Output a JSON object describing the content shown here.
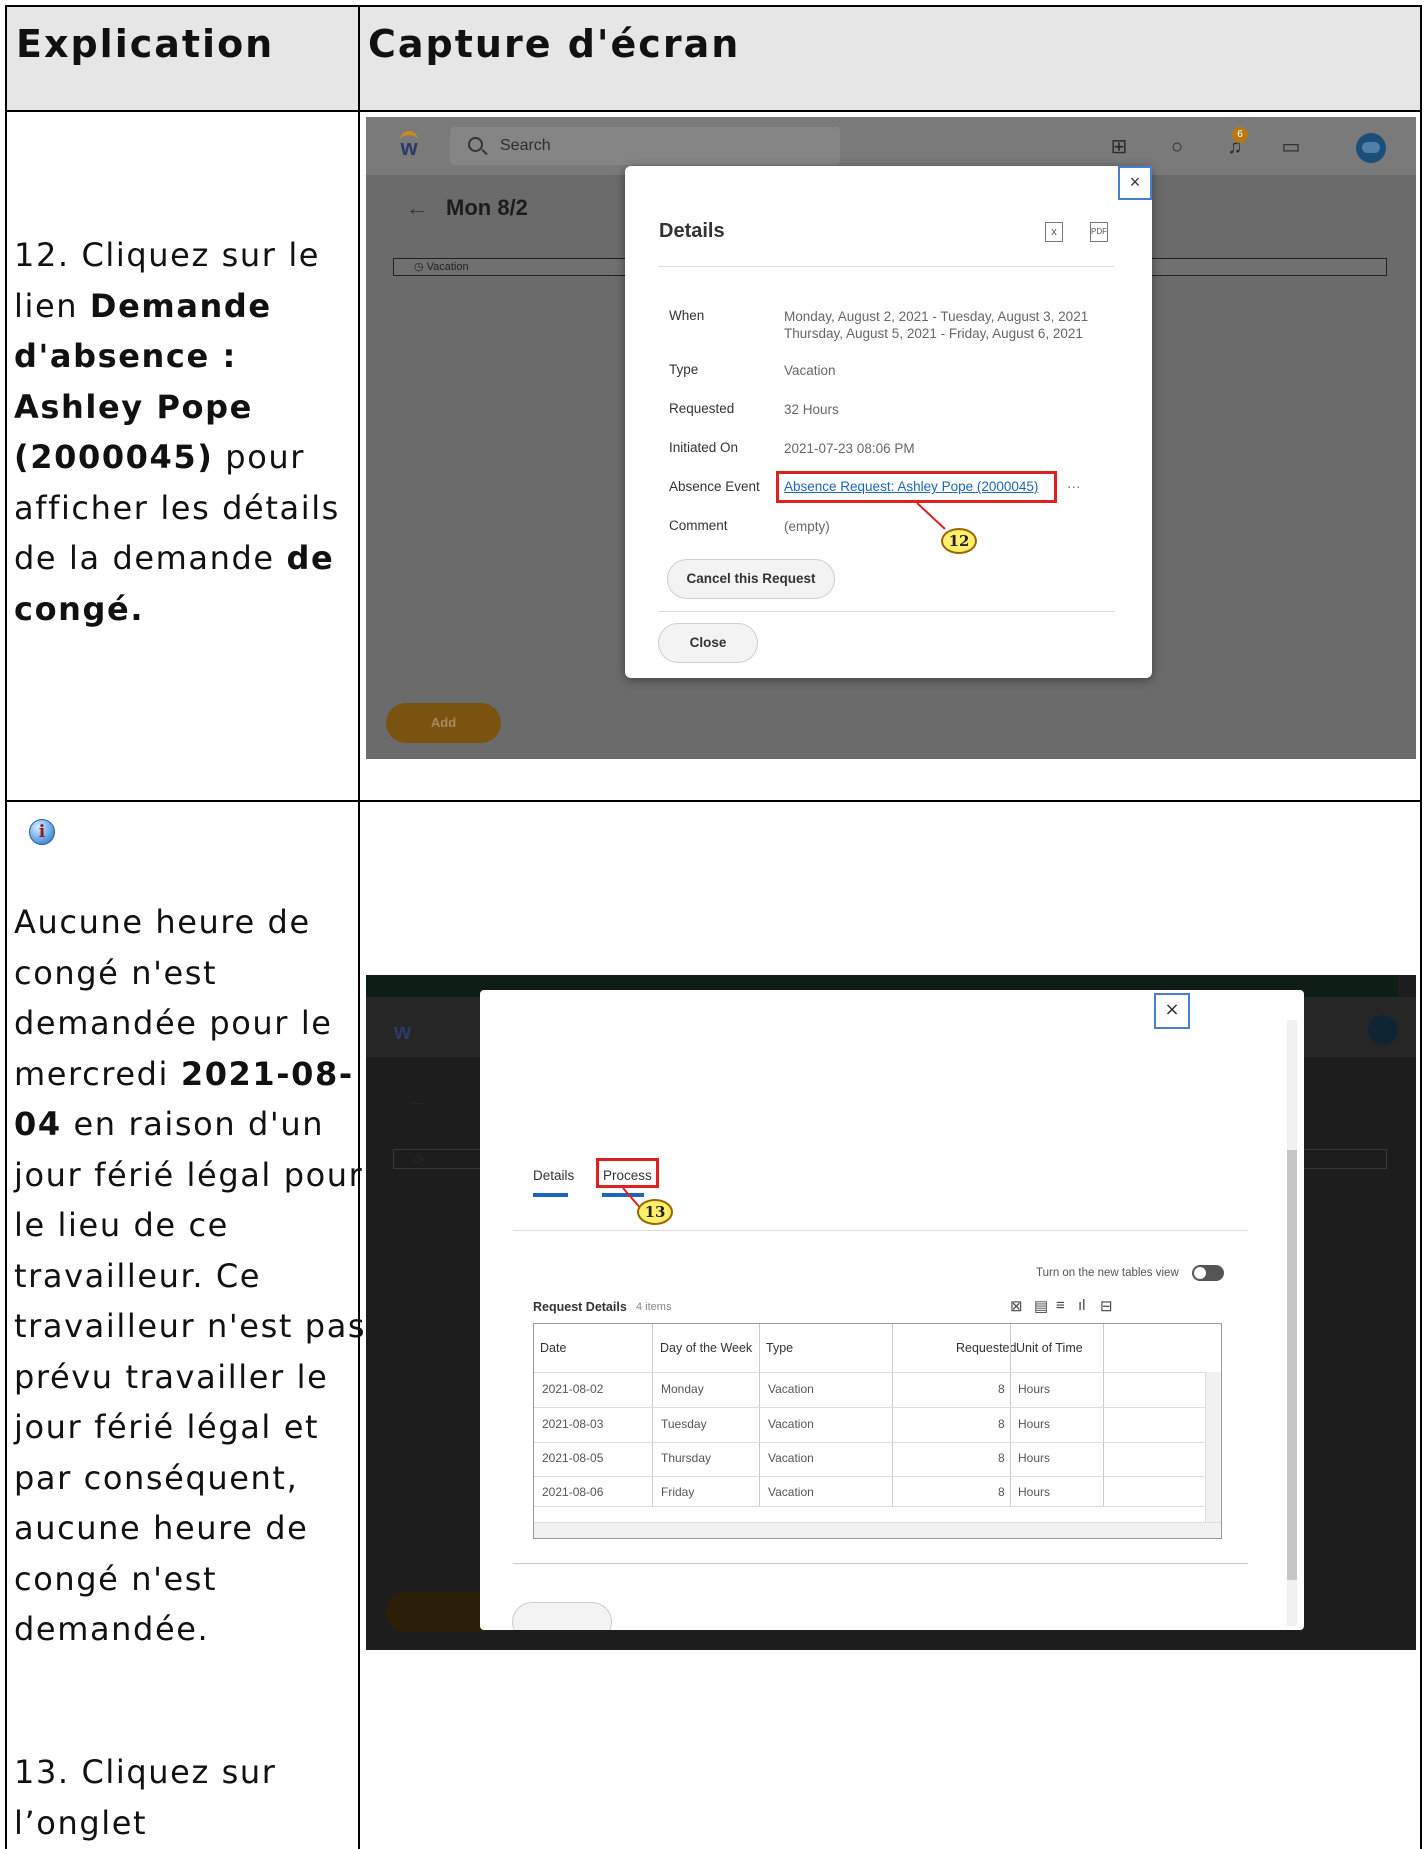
{
  "document": {
    "header_left": "Explication",
    "header_right": "Capture d'écran",
    "step12_prefix": "12. Cliquez sur le lien ",
    "step12_bold_link": "Demande d'absence : Ashley Pope (2000045)",
    "step12_middle": " pour afficher les détails de la demande ",
    "step12_bold_end": "de congé.",
    "info_icon": "info-icon",
    "note_1": "Aucune heure de congé n'est demandée pour le mercredi ",
    "note_bold_date": "2021-08-04",
    "note_2": " en raison d'un jour férié légal pour le lieu de ce travailleur. Ce travailleur n'est pas prévu travailler le jour férié légal et par conséquent, aucune heure de congé n'est demandée.",
    "step13_text": "13. Cliquez sur l’onglet"
  },
  "screenshot1": {
    "search_placeholder": "Search",
    "notification_count": "6",
    "page_title": "Mon 8/2",
    "bar_label": "Vacation",
    "add_button": "Add",
    "modal": {
      "title": "Details",
      "close_symbol": "×",
      "rows": [
        {
          "label": "When",
          "value": "Monday, August 2, 2021 - Tuesday, August 3, 2021",
          "value2": "Thursday, August 5, 2021 - Friday, August 6, 2021"
        },
        {
          "label": "Type",
          "value": "Vacation"
        },
        {
          "label": "Requested",
          "value": "32 Hours"
        },
        {
          "label": "Initiated On",
          "value": "2021-07-23 08:06 PM"
        },
        {
          "label": "Absence Event",
          "value": "Absence Request: Ashley Pope (2000045)"
        },
        {
          "label": "Comment",
          "value": "(empty)"
        }
      ],
      "cancel_button": "Cancel this Request",
      "close_button": "Close",
      "step_badge": "12"
    }
  },
  "screenshot2": {
    "modal": {
      "close_symbol": "×",
      "rows": [
        [
          "2021-08-02",
          "Monday",
          "Vacation",
          "8",
          "Hours"
        ],
        [
          "2021-08-03",
          "Tuesday",
          "Vacation",
          "8",
          "Hours"
        ],
        [
          "2021-08-05",
          "Thursday",
          "Vacation",
          "8",
          "Hours"
        ],
        [
          "2021-08-06",
          "Friday",
          "Vacation",
          "8",
          "Hours"
        ]
      ],
      "tabs": [
        "Details",
        "Process"
      ],
      "step_badge": "13",
      "toggle_label": "Turn on the new tables view",
      "table_title": "Request Details",
      "table_count": "4 items",
      "columns": [
        "Date",
        "Day of the Week",
        "Type",
        "Requested",
        "Unit of Time"
      ]
    }
  }
}
